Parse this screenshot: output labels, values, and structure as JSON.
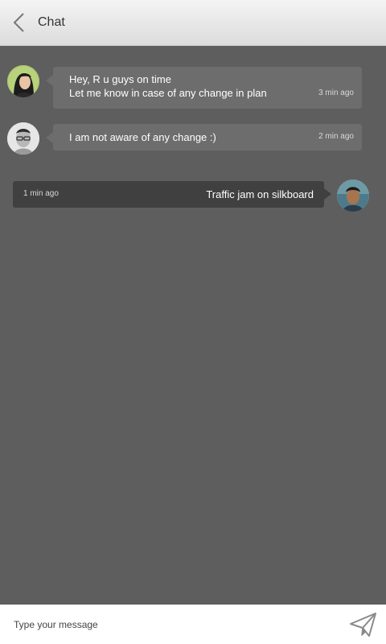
{
  "header": {
    "title": "Chat",
    "back_icon": "chevron-left-icon"
  },
  "messages": [
    {
      "direction": "incoming",
      "avatar": "avatar-woman",
      "lines": [
        "Hey, R u guys on time",
        "Let me know in case of any change in plan"
      ],
      "time": "3 min ago"
    },
    {
      "direction": "incoming",
      "avatar": "avatar-man-glasses",
      "lines": [
        "I am not aware of any change :)"
      ],
      "time": "2 min ago"
    },
    {
      "direction": "outgoing",
      "avatar": "avatar-man",
      "lines": [
        "Traffic jam on silkboard"
      ],
      "time": "1 min ago"
    }
  ],
  "composer": {
    "placeholder": "Type your message",
    "value": "",
    "send_icon": "send-paper-plane-icon"
  },
  "colors": {
    "background": "#5e5e5e",
    "incoming_bubble": "#6d6d6d",
    "outgoing_bubble": "#404040",
    "header": "#e8e8e8"
  }
}
